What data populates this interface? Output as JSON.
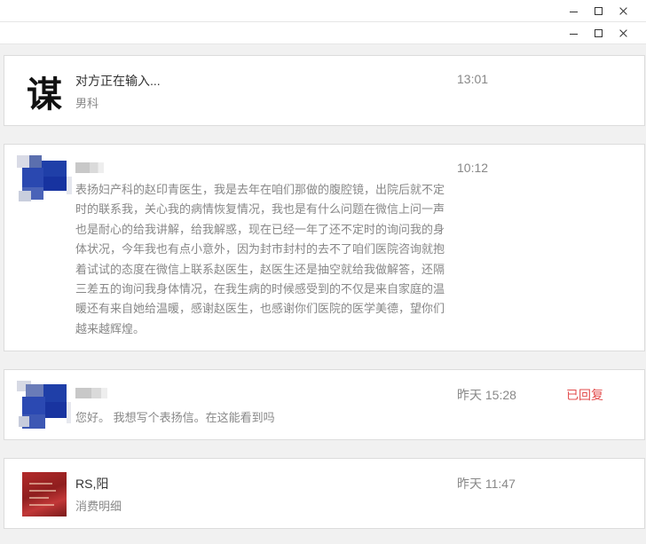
{
  "window": {
    "controls": [
      "minimize",
      "maximize",
      "close"
    ]
  },
  "conversations": [
    {
      "avatar": "logo",
      "avatar_glyph": "谋",
      "name": "对方正在输入...",
      "subtitle": "男科",
      "time": "13:01",
      "status": ""
    },
    {
      "avatar": "pixelated",
      "name": "",
      "subtitle": "",
      "message": "表扬妇产科的赵印青医生，我是去年在咱们那做的腹腔镜，出院后就不定时的联系我，关心我的病情恢复情况，我也是有什么问题在微信上问一声也是耐心的给我讲解，给我解惑，现在已经一年了还不定时的询问我的身体状况，今年我也有点小意外，因为封市封村的去不了咱们医院咨询就抱着试试的态度在微信上联系赵医生，赵医生还是抽空就给我做解答，还隔三差五的询问我身体情况，在我生病的时候感受到的不仅是来自家庭的温暖还有来自她给温暖，感谢赵医生，也感谢你们医院的医学美德，望你们越来越辉煌。",
      "time": "10:12",
      "status": ""
    },
    {
      "avatar": "pixelated",
      "name": "",
      "subtitle": "您好。 我想写个表扬信。在这能看到吗",
      "time": "昨天 15:28",
      "status": "已回复"
    },
    {
      "avatar": "red-photo",
      "name": "RS,阳",
      "subtitle": "消费明细",
      "time": "昨天 11:47",
      "status": ""
    }
  ],
  "colors": {
    "status_replied": "#e34d4d",
    "mosaic_blue": "#1f3fa8"
  }
}
